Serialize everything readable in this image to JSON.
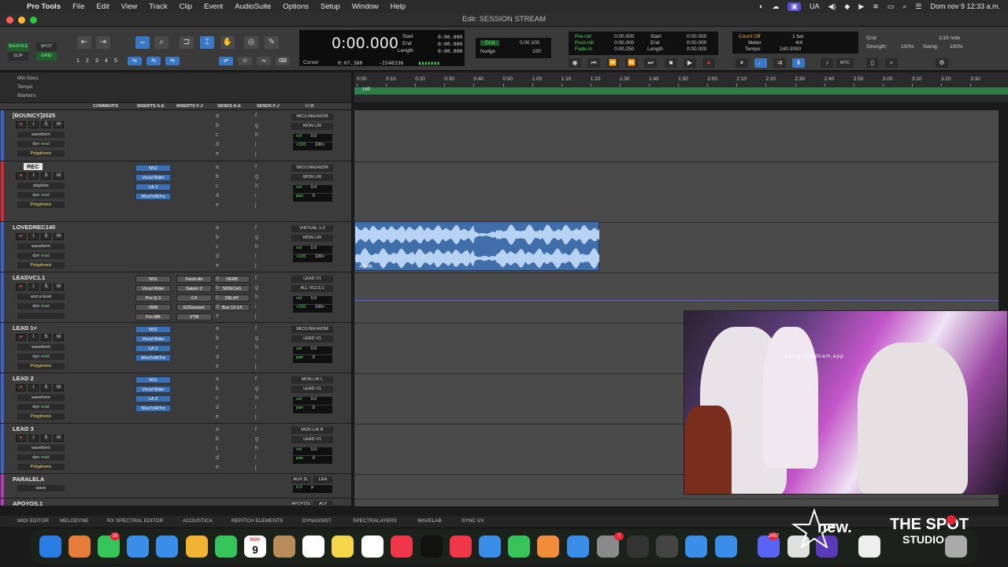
{
  "menubar": {
    "app": "Pro Tools",
    "items": [
      "File",
      "Edit",
      "View",
      "Track",
      "Clip",
      "Event",
      "AudioSuite",
      "Options",
      "Setup",
      "Window",
      "Help"
    ],
    "lang": "UA",
    "datetime": "Dom nov 9  12:33 a.m."
  },
  "window": {
    "title": "Edit: SESSION STREAM"
  },
  "toolbar": {
    "shuffle": "SHUFFLE",
    "spot": "SPOT",
    "slip": "SLIP",
    "grid": "GRID",
    "zoom_presets": [
      "1",
      "2",
      "3",
      "4",
      "5"
    ],
    "cursor_label": "Cursor",
    "cursor_value": "0:07.380",
    "counter_main": "0:00.000",
    "start_label": "Start",
    "end_label": "End",
    "length_label": "Length",
    "start": "0:00.000",
    "end": "0:00.000",
    "length": "0:00.000",
    "samples": "-1548336",
    "grid_label": "Grid",
    "grid_value": "0:00.100",
    "nudge_label": "Nudge",
    "nudge_value": "100",
    "preroll_label": "Pre-roll",
    "postroll_label": "Post-roll",
    "fadein_label": "Fade-in",
    "preroll": "0:00.000",
    "postroll": "0:00.000",
    "fadein": "0:00.250",
    "start2": "0:00.000",
    "end2": "0:00.000",
    "length2": "0:00.000",
    "countoff_label": "Count Off",
    "countoff_value": "1 bar",
    "meter_label": "Meter",
    "meter_value": "4/4",
    "tempo_label": "Tempo",
    "tempo_value": "140.0000",
    "grid2_label": "Grid:",
    "grid2_value": "1/16 note",
    "strength_label": "Strength:",
    "strength_value": "100%",
    "swing_label": "Swing:",
    "swing_value": "100%",
    "mtc": "MTC"
  },
  "rulers": {
    "labels": [
      "Min:Secs",
      "Tempo",
      "Markers"
    ],
    "tempo_marker": "140",
    "ticks": [
      "0:00",
      "0:10",
      "0:20",
      "0:30",
      "0:40",
      "0:50",
      "1:00",
      "1:10",
      "1:20",
      "1:30",
      "1:40",
      "1:50",
      "2:00",
      "2:10",
      "2:20",
      "2:30",
      "2:40",
      "2:50",
      "3:00",
      "3:10",
      "3:20",
      "3:30"
    ]
  },
  "columns": [
    "COMMENTS",
    "INSERTS A-E",
    "INSERTS F-J",
    "SENDS A-E",
    "SENDS F-J",
    "I / O"
  ],
  "tracks": [
    {
      "name": "[BOUNCY]2025",
      "view": "waveform",
      "auto": "read",
      "dyn": "dyn",
      "poly": "Polyphonic",
      "io_in": "MIC/LINE/HIZ/M",
      "io_out": "MON L/R",
      "vol": "vol",
      "vol_val": "0.0",
      "pan": "<100",
      "pan2": "100>",
      "inserts": []
    },
    {
      "name": "REC",
      "view": "playlists",
      "auto": "read",
      "dyn": "dyn",
      "poly": "Polyphonic",
      "io_in": "MIC/LINE/HIZ/M",
      "io_out": "MON L/R",
      "vol": "vol",
      "vol_val": "0.0",
      "pan": "pan",
      "pan2": "0",
      "inserts": [
        "NS1",
        "Vocal Rider",
        "LA-2",
        "WvsTnRtTm"
      ]
    },
    {
      "name": "LOVEDREC140",
      "view": "waveform",
      "auto": "read",
      "dyn": "dyn",
      "poly": "Polyphonic",
      "io_in": "VIRTUAL 1-2",
      "io_out": "MON L/R",
      "vol": "vol",
      "vol_val": "0.0",
      "pan": "<100",
      "pan2": "100>",
      "inserts": []
    },
    {
      "name": "LEADVC1.1",
      "view": "and a level",
      "auto": "read",
      "dyn": "dyn",
      "poly": "",
      "io_in": "LEAD V1",
      "io_out": "ALL VCLS.1",
      "vol": "vol",
      "vol_val": "0.0",
      "pan": "<100",
      "pan2": "100>",
      "inserts": [
        "NS1",
        "Vocal Rider",
        "Pro-Q 3",
        "VMR",
        "Pro-MB"
      ],
      "inserts2": [
        "Fresh Air",
        "Saturn 2",
        "C4",
        "E2Deesser",
        "VTM"
      ],
      "sends": [
        "VERB",
        "SIDECH1",
        "DELAY",
        "Bus 13-14"
      ]
    },
    {
      "name": "LEAD 1+",
      "view": "waveform",
      "auto": "read",
      "dyn": "dyn",
      "poly": "Polyphonic",
      "io_in": "MIC/LINE/HIZ/M",
      "io_out": "LEAD V1",
      "vol": "vol",
      "vol_val": "0.0",
      "pan": "pan",
      "pan2": "0",
      "inserts": [
        "NS1",
        "Vocal Rider",
        "LA-2",
        "WvsTnRtTm"
      ]
    },
    {
      "name": "LEAD 2",
      "view": "waveform",
      "auto": "read",
      "dyn": "dyn",
      "poly": "Polyphonic",
      "io_in": "MON L/R L",
      "io_out": "LEAD V1",
      "vol": "vol",
      "vol_val": "0.0",
      "pan": "pan",
      "pan2": "0",
      "inserts": [
        "NS1",
        "Vocal Rider",
        "LA-2",
        "WvsTnRtTm"
      ]
    },
    {
      "name": "LEAD 3",
      "view": "waveform",
      "auto": "read",
      "dyn": "dyn",
      "poly": "Polyphonic",
      "io_in": "MON L/R R",
      "io_out": "LEAD V1",
      "vol": "vol",
      "vol_val": "0.0",
      "pan": "pan",
      "pan2": "0",
      "inserts": []
    },
    {
      "name": "PARALELA",
      "view": "wave",
      "auto": "read",
      "dyn": "",
      "poly": "",
      "io_in": "AUX 2L",
      "io_out": "LEA",
      "vol": "0.0",
      "vol_val": "p",
      "pan": "",
      "pan2": "",
      "inserts": []
    },
    {
      "name": "APOYOS.1",
      "view": "",
      "auto": "",
      "dyn": "",
      "poly": "",
      "io_in": "APOYOS",
      "io_out": "ALV",
      "vol": "",
      "vol_val": "",
      "pan": "",
      "pan2": "",
      "inserts": []
    }
  ],
  "clip": {
    "gain_label": "-4.6 dB"
  },
  "webcam": {
    "watermark": "using droidcam.app"
  },
  "plugin_bar": [
    "MIDI EDITOR",
    "MELODYNE",
    "RX SPECTRAL EDITOR",
    "ACOUSTICA",
    "REPITCH ELEMENTS",
    "DYNASSIST",
    "SPECTRALAYERS",
    "WAVELAB",
    "SYNC VX"
  ],
  "dock": {
    "calendar_month": "NOV",
    "calendar_day": "9",
    "messages_badge": "16",
    "settings_badge": "2",
    "discord_badge": "2487",
    "apps": [
      "finder-icon",
      "launchpad-icon",
      "messages-icon",
      "mail-icon",
      "safari-icon",
      "photos-icon",
      "facetime-icon",
      "calendar-icon",
      "contacts-icon",
      "reminders-icon",
      "notes-icon",
      "freeform-icon",
      "music-icon",
      "tv-icon",
      "news-icon",
      "keynote-icon",
      "numbers-icon",
      "pages-icon",
      "appstore-icon",
      "settings-icon",
      "protools-icon",
      "capcut-icon",
      "safari2-icon",
      "ichat-icon",
      "discord-icon",
      "chrome-icon",
      "obs-icon",
      "music2-icon",
      "trash-icon"
    ]
  },
  "logos": {
    "new": "new.",
    "spot_line1": "THE SPOT",
    "spot_line2": "STUDIO"
  },
  "colors": {
    "accent_blue": "#3f6ea8",
    "rec_red": "#e03c3c",
    "marker_green": "#2f7d4a",
    "timecode_green": "#5fe35f"
  }
}
